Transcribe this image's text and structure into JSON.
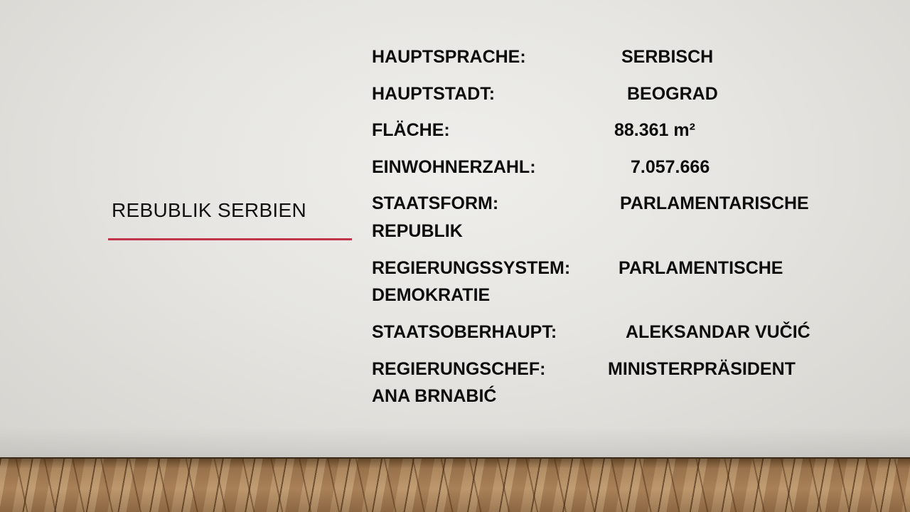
{
  "slide": {
    "title": "REBUBLIK SERBIEN",
    "accent_color": "#c1344b",
    "facts": [
      {
        "label": "HAUPTSPRACHE:",
        "value": "SERBISCH"
      },
      {
        "label": "HAUPTSTADT:",
        "value": "BEOGRAD"
      },
      {
        "label": "FLÄCHE:",
        "value": "88.361 m²"
      },
      {
        "label": "EINWOHNERZAHL:",
        "value": "7.057.666"
      },
      {
        "label": "STAATSFORM:",
        "value": "PARLAMENTARISCHE",
        "continuation": "REPUBLIK"
      },
      {
        "label": "REGIERUNGSSYSTEM:",
        "value": "PARLAMENTISCHE",
        "continuation": "DEMOKRATIE"
      },
      {
        "label": "STAATSOBERHAUPT:",
        "value": "ALEKSANDAR VUČIĆ"
      },
      {
        "label": "REGIERUNGSCHEF:",
        "value": "MINISTERPRÄSIDENT",
        "continuation": "ANA BRNABIĆ"
      }
    ]
  }
}
